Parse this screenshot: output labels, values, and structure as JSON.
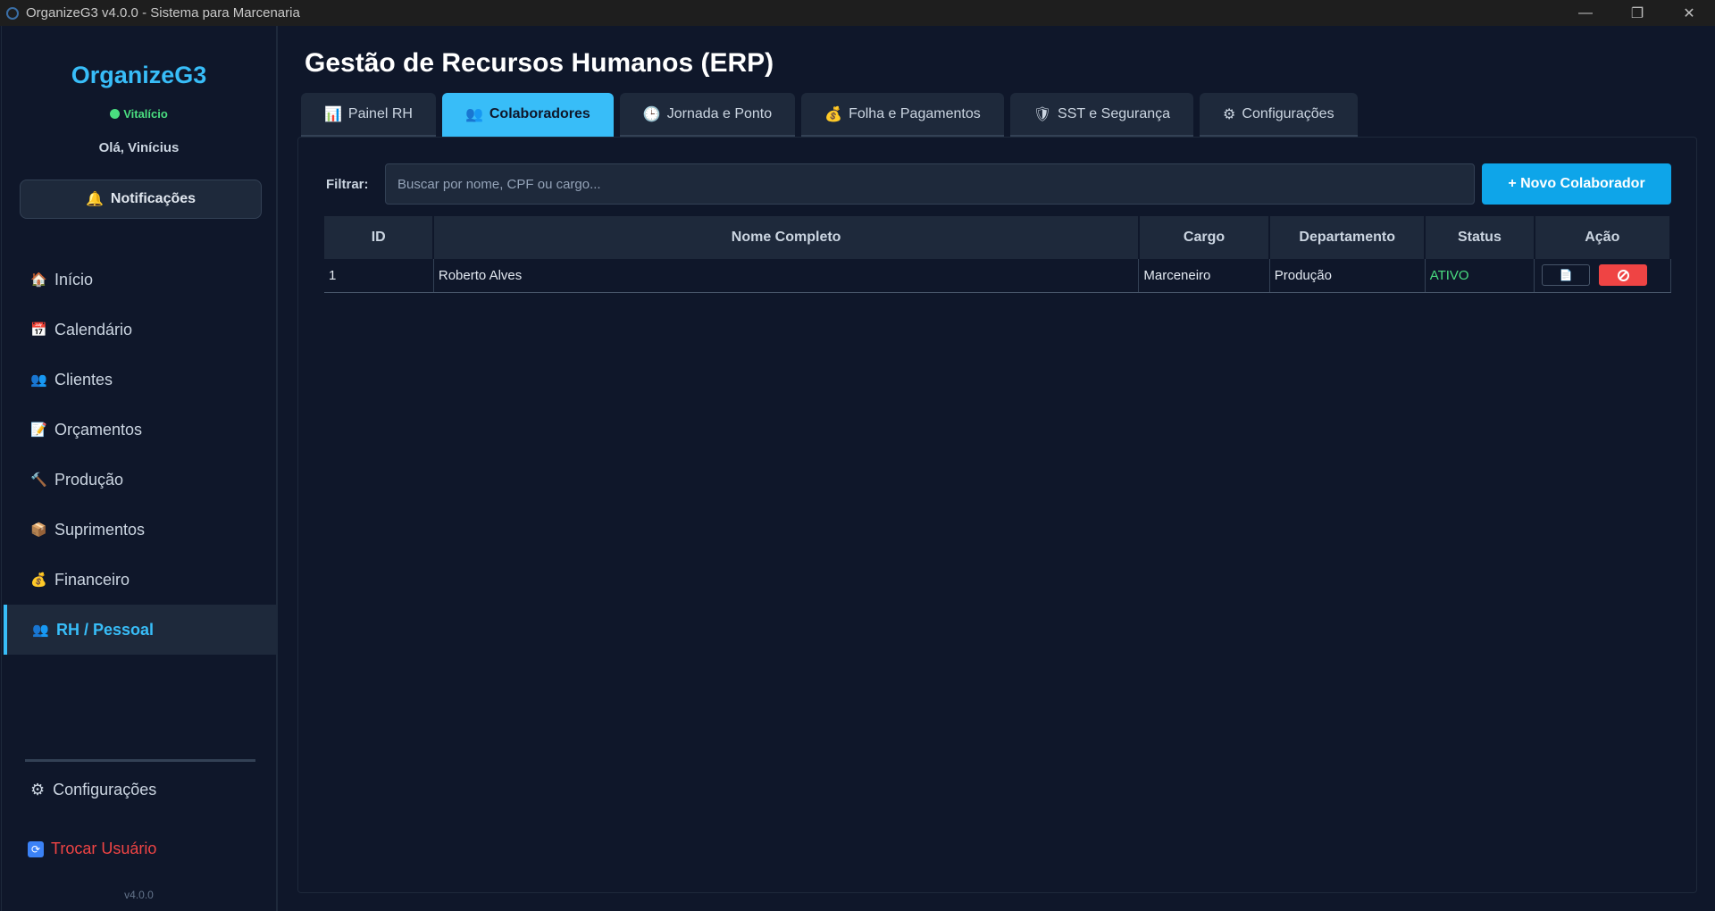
{
  "window": {
    "title": "OrganizeG3 v4.0.0 - Sistema para Marcenaria",
    "controls": {
      "minimize": "—",
      "restore": "❐",
      "close": "✕"
    }
  },
  "sidebar": {
    "brand": "OrganizeG3",
    "license": "Vitalício",
    "greeting": "Olá, Vinícius",
    "notifications": {
      "icon": "🔔",
      "label": "Notificações"
    },
    "items": [
      {
        "icon": "🏠",
        "label": "Início"
      },
      {
        "icon": "📅",
        "label": "Calendário"
      },
      {
        "icon": "👥",
        "label": "Clientes"
      },
      {
        "icon": "📝",
        "label": "Orçamentos"
      },
      {
        "icon": "🔨",
        "label": "Produção"
      },
      {
        "icon": "📦",
        "label": "Suprimentos"
      },
      {
        "icon": "💰",
        "label": "Financeiro"
      },
      {
        "icon": "👥",
        "label": "RH / Pessoal"
      }
    ],
    "settings": {
      "icon": "⚙",
      "label": "Configurações"
    },
    "switch_user": {
      "icon": "🔄",
      "label": "Trocar Usuário"
    },
    "version": "v4.0.0"
  },
  "main": {
    "title": "Gestão de Recursos Humanos (ERP)",
    "tabs": [
      {
        "icon": "📊",
        "label": "Painel RH"
      },
      {
        "icon": "👥",
        "label": "Colaboradores"
      },
      {
        "icon": "🕒",
        "label": "Jornada e Ponto"
      },
      {
        "icon": "💰",
        "label": "Folha e Pagamentos"
      },
      {
        "icon": "🛡",
        "label": "SST e Segurança"
      },
      {
        "icon": "⚙",
        "label": "Configurações"
      }
    ],
    "active_tab": "Colaboradores",
    "filter": {
      "label": "Filtrar:",
      "placeholder": "Buscar por nome, CPF ou cargo...",
      "value": ""
    },
    "new_button": "+ Novo Colaborador",
    "table": {
      "headers": [
        "ID",
        "Nome Completo",
        "Cargo",
        "Departamento",
        "Status",
        "Ação"
      ],
      "rows": [
        {
          "id": "1",
          "name": "Roberto Alves",
          "role": "Marceneiro",
          "department": "Produção",
          "status": "ATIVO",
          "edit_icon": "📄",
          "deactivate_icon": "ban-icon"
        }
      ]
    }
  },
  "colors": {
    "accent": "#38bdf8",
    "button": "#0ea5e9",
    "danger": "#ef4444",
    "success": "#4ade80",
    "background": "#0f172a",
    "surface": "#1e293b"
  }
}
